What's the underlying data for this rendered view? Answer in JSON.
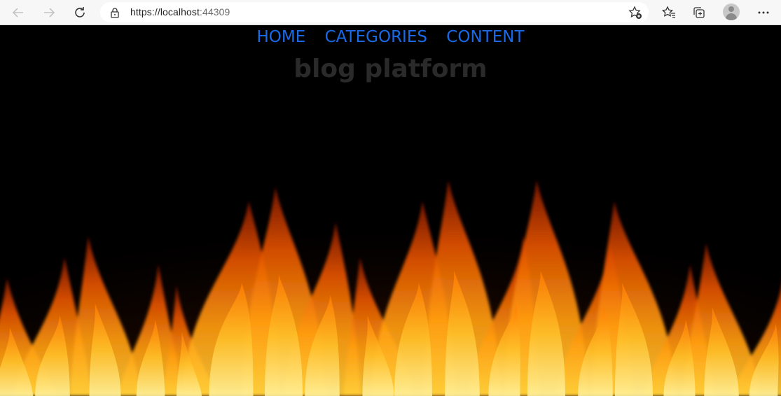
{
  "browser": {
    "url_protocol": "https://",
    "url_host": "localhost",
    "url_port": ":44309",
    "icons": [
      "back-icon",
      "forward-icon",
      "refresh-icon",
      "lock-icon",
      "add-favorite-icon",
      "favorites-icon",
      "collections-icon",
      "profile-icon",
      "more-icon"
    ]
  },
  "nav": {
    "items": [
      "HOME",
      "CATEGORIES",
      "CONTENT"
    ]
  },
  "site": {
    "title": "blog platform"
  },
  "colors": {
    "nav_link": "#1a6ae8",
    "title": "#2a2a2a",
    "background": "#000000",
    "fire_core": "#ffb800",
    "fire_outer": "#e34a00"
  }
}
